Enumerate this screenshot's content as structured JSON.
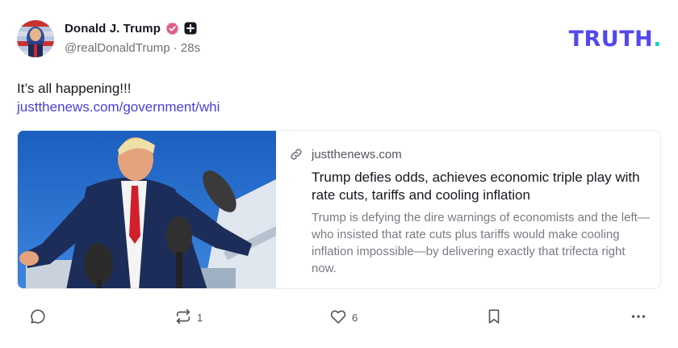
{
  "colors": {
    "brand": "#5448ee",
    "brand_accent": "#19d3c5",
    "link": "#4a3fd8",
    "verified": "#e35d86",
    "muted": "#6f6f7a"
  },
  "post": {
    "author": {
      "display_name": "Donald J. Trump",
      "handle": "@realDonaldTrump",
      "separator": " · ",
      "time_ago": "28s",
      "verified_icon": "verified-badge-icon",
      "plus_icon": "plus-square-icon"
    },
    "brand": {
      "text": "TRUTH",
      "dot": "."
    },
    "text": "It’s all happening!!!",
    "link_text": "justthenews.com/government/whi",
    "card": {
      "image_alt": "Trump speaking to reporters with microphones",
      "domain_icon": "link-icon",
      "domain": "justthenews.com",
      "title": "Trump defies odds, achieves economic triple play with rate cuts, tariffs and cooling inflation",
      "description": "Trump is defying the dire warnings of economists and the left—who insisted that rate cuts plus tariffs would make cooling inflation impossible—by delivering exactly that trifecta right now."
    },
    "actions": {
      "reply": {
        "icon": "reply-icon",
        "count": ""
      },
      "retruth": {
        "icon": "retruth-icon",
        "count": "1"
      },
      "like": {
        "icon": "heart-icon",
        "count": "6"
      },
      "bookmark": {
        "icon": "bookmark-icon"
      },
      "more": {
        "icon": "more-icon"
      }
    }
  }
}
